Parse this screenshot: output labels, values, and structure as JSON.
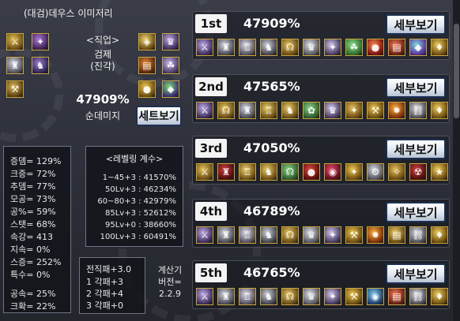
{
  "header": {
    "title": "(대검)데우스 이미저리",
    "job_label": "<직업>",
    "job_name_line1": "검제",
    "job_name_line2": "(진각)",
    "damage_pct": "47909%",
    "damage_label": "순데미지",
    "set_button": "세트보기"
  },
  "stats": [
    "증뎀= 129%",
    "크증= 72%",
    "추뎀= 77%",
    "모공= 73%",
    "공%= 59%",
    "스탯= 68%",
    "속강= 413",
    "지속= 0%",
    "스증= 252%",
    "특수= 0%",
    "공속= 25%",
    "크확= 22%"
  ],
  "leveling": {
    "title": "<레벨링 계수>",
    "lines": [
      "1~45+3 : 41570%",
      "50Lv+3 : 46234%",
      "60~80+3 : 42979%",
      "85Lv+3 : 52612%",
      "95Lv+0 : 38660%",
      "100Lv+3 : 60491%"
    ]
  },
  "pae": {
    "lines": [
      "전직패+3.0",
      "1 각패+3",
      "2 각패+4",
      "3 각패+0"
    ]
  },
  "calc": {
    "line1": "계산기",
    "line2": "버전=",
    "line3": "2.2.9"
  },
  "ranks": [
    {
      "badge": "1st",
      "pct": "47909%",
      "button": "세부보기"
    },
    {
      "badge": "2nd",
      "pct": "47565%",
      "button": "세부보기"
    },
    {
      "badge": "3rd",
      "pct": "47050%",
      "button": "세부보기"
    },
    {
      "badge": "4th",
      "pct": "46789%",
      "button": "세부보기"
    },
    {
      "badge": "5th",
      "pct": "46765%",
      "button": "세부보기"
    }
  ],
  "colors": {
    "accent_gold": "#c9a640",
    "button_border": "#1c2f55",
    "panel_bg": "#12141a"
  }
}
